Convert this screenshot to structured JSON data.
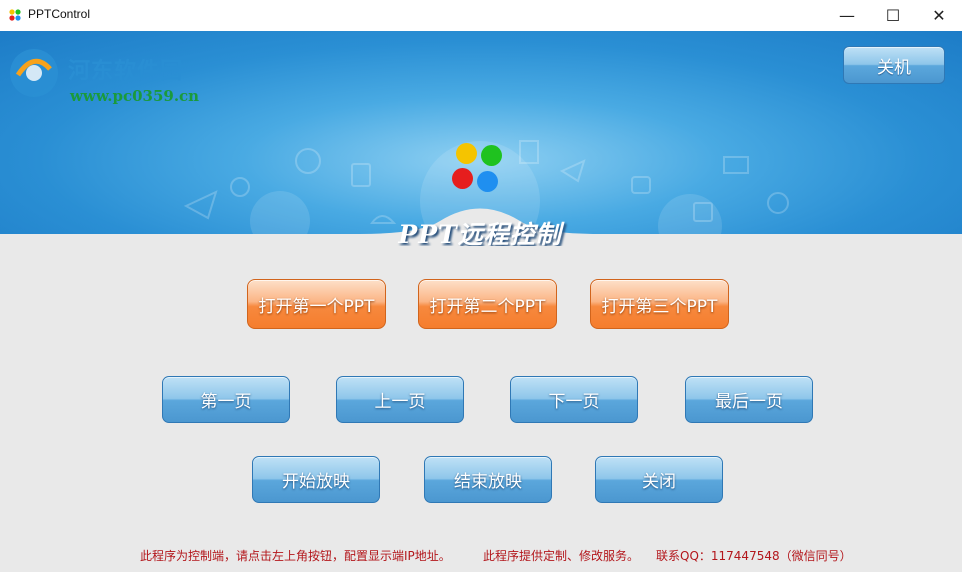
{
  "window": {
    "title": "PPTControl",
    "minimize_symbol": "—",
    "maximize_symbol": "☐",
    "close_symbol": "✕"
  },
  "watermark": {
    "site_name": "河东软件园",
    "url": "www.pc0359.cn"
  },
  "header": {
    "shutdown_label": "关机",
    "app_title": "PPT远程控制",
    "logo_colors": [
      "#f5c400",
      "#1fc21f",
      "#e61e1e",
      "#1f8ff0"
    ]
  },
  "open_buttons": [
    "打开第一个PPT",
    "打开第二个PPT",
    "打开第三个PPT"
  ],
  "nav_buttons": [
    "第一页",
    "上一页",
    "下一页",
    "最后一页"
  ],
  "show_buttons": [
    "开始放映",
    "结束放映",
    "关闭"
  ],
  "footer": {
    "hint": "此程序为控制端，请点击左上角按钮，配置显示端IP地址。",
    "service": "此程序提供定制、修改服务。",
    "contact": "联系QQ：117447548（微信同号）"
  },
  "colors": {
    "accent_blue": "#2a8fd4",
    "accent_orange": "#f57d2d",
    "footer_red": "#b3161b"
  }
}
